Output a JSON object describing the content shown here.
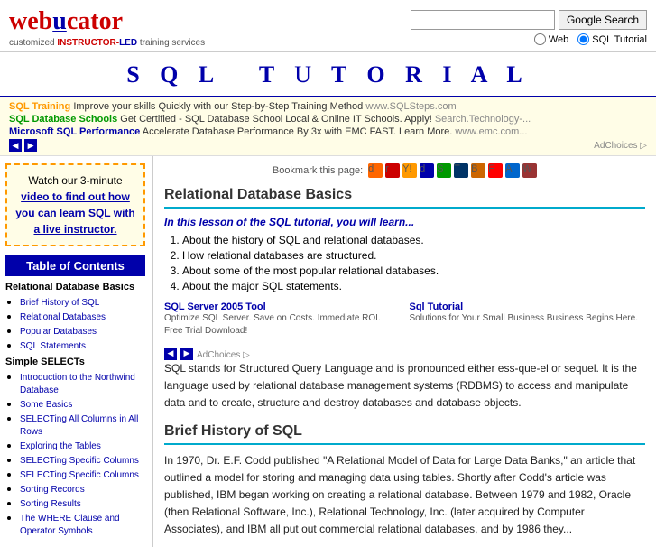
{
  "header": {
    "logo": {
      "web": "web",
      "u": "u",
      "cator": "cator",
      "tagline_pre": "customized",
      "tagline_instructor": "INSTRUCTOR-",
      "tagline_led": "LED",
      "tagline_post": "training services"
    },
    "search": {
      "placeholder": "",
      "button_label": "Google Search"
    },
    "radio": {
      "option1": "Web",
      "option2": "SQL Tutorial",
      "selected": "option2"
    }
  },
  "banner": {
    "title": "S Q L   T u t o r i a l"
  },
  "ads": [
    {
      "link_text": "SQL Training",
      "link_color": "orange",
      "text": " Improve your skills Quickly with our Step-by-Step Training Method ",
      "url_text": "www.SQLSteps.com"
    },
    {
      "link_text": "SQL Database Schools",
      "link_color": "green",
      "text": " Get Certified - SQL Database School Local & Online IT Schools. Apply! ",
      "url_text": "Search.Technology-..."
    },
    {
      "link_text": "Microsoft SQL Performance",
      "link_color": "blue",
      "text": " Accelerate Database Performance By 3x with EMC FAST. Learn More. ",
      "url_text": "www.emc.com..."
    }
  ],
  "ad_choices": "AdChoices ▷",
  "sidebar": {
    "promo": {
      "line1": "Watch our 3-minute",
      "link_text": "video to find out how you can learn SQL with a live instructor.",
      "link_href": "#"
    },
    "toc_heading": "Table of Contents",
    "sections": [
      {
        "title": "Relational Database Basics",
        "items": [
          "Brief History of SQL",
          "Relational Databases",
          "Popular Databases",
          "SQL Statements"
        ]
      },
      {
        "title": "Simple SELECTs",
        "items": [
          "Introduction to the Northwind Database",
          "Some Basics",
          "SELECTing All Columns in All Rows",
          "Exploring the Tables",
          "SELECTing Specific Columns",
          "SELECTing Specific Columns",
          "Sorting Records",
          "Sorting Results",
          "The WHERE Clause and Operator Symbols"
        ]
      }
    ]
  },
  "content": {
    "bookmark_text": "Bookmark this page:",
    "section_title": "Relational Database Basics",
    "lesson_intro": "In this lesson of the SQL tutorial, you will learn...",
    "lesson_items": [
      "About the history of SQL and relational databases.",
      "How relational databases are structured.",
      "About some of the most popular relational databases.",
      "About the major SQL statements."
    ],
    "content_ads": [
      {
        "title": "SQL Server 2005 Tool",
        "text": "Optimize SQL Server. Save on Costs. Immediate ROI. Free Trial Download!"
      },
      {
        "title": "Sql Tutorial",
        "text": "Solutions for Your Small Business Business Begins Here."
      }
    ],
    "ad_choices2": "AdChoices ▷",
    "sql_desc": "SQL stands for Structured Query Language and is pronounced either ess-que-el or sequel. It is the language used by relational database management systems (RDBMS) to access and manipulate data and to create, structure and destroy databases and database objects.",
    "brief_title": "Brief History of SQL",
    "brief_text": "In 1970, Dr. E.F. Codd published \"A Relational Model of Data for Large Data Banks,\" an article that outlined a model for storing and managing data using tables. Shortly after Codd's article was published, IBM began working on creating a relational database. Between 1979 and 1982, Oracle (then Relational Software, Inc.), Relational Technology, Inc. (later acquired by Computer Associates), and IBM all put out commercial relational databases, and by 1986 they..."
  }
}
